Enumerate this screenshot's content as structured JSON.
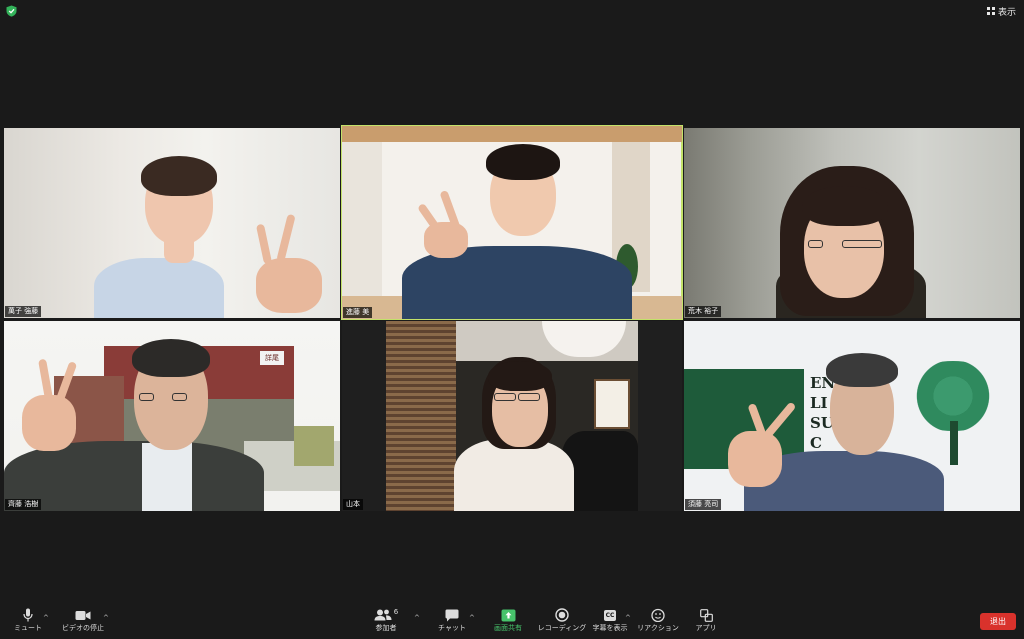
{
  "topbar": {
    "view_label": "表示",
    "shield_color": "#33b35a"
  },
  "participants": [
    {
      "name": "萬子 強藤",
      "active": false
    },
    {
      "name": "進藤 美",
      "active": true
    },
    {
      "name": "荒木 裕子",
      "active": false
    },
    {
      "name": "齊藤 浩樹",
      "active": false
    },
    {
      "name": "山本",
      "active": false
    },
    {
      "name": "須藤 亮司",
      "active": false
    }
  ],
  "background_text": {
    "store_sign": "詳尾",
    "org_lines": [
      "EN",
      "LI",
      "SU  RTER",
      "C"
    ]
  },
  "toolbar": {
    "mute_label": "ミュート",
    "video_label": "ビデオの停止",
    "participants_label": "参加者",
    "participants_count": "6",
    "chat_label": "チャット",
    "share_label": "画面共有",
    "record_label": "レコーディング",
    "cc_label": "字幕を表示",
    "cc_icon_text": "CC",
    "reactions_label": "リアクション",
    "apps_label": "アプリ",
    "end_label": "退出",
    "accent_green": "#47c36b",
    "end_color": "#d9322c"
  }
}
